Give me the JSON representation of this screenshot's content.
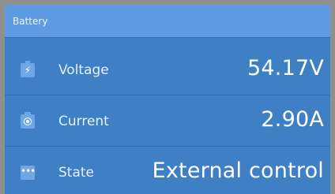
{
  "header": {
    "title": "Battery"
  },
  "rows": [
    {
      "label": "Voltage",
      "value": "54.17V",
      "icon": "battery-bolt-icon"
    },
    {
      "label": "Current",
      "value": "2.90A",
      "icon": "current-icon"
    },
    {
      "label": "State",
      "value": "External control",
      "icon": "more-dots-icon"
    }
  ],
  "colors": {
    "panel": "#3f7fc3",
    "header": "#5f9be0",
    "separator": "#2f6fb3",
    "icon_bg": "#6fa7e6",
    "text": "#ffffff"
  }
}
